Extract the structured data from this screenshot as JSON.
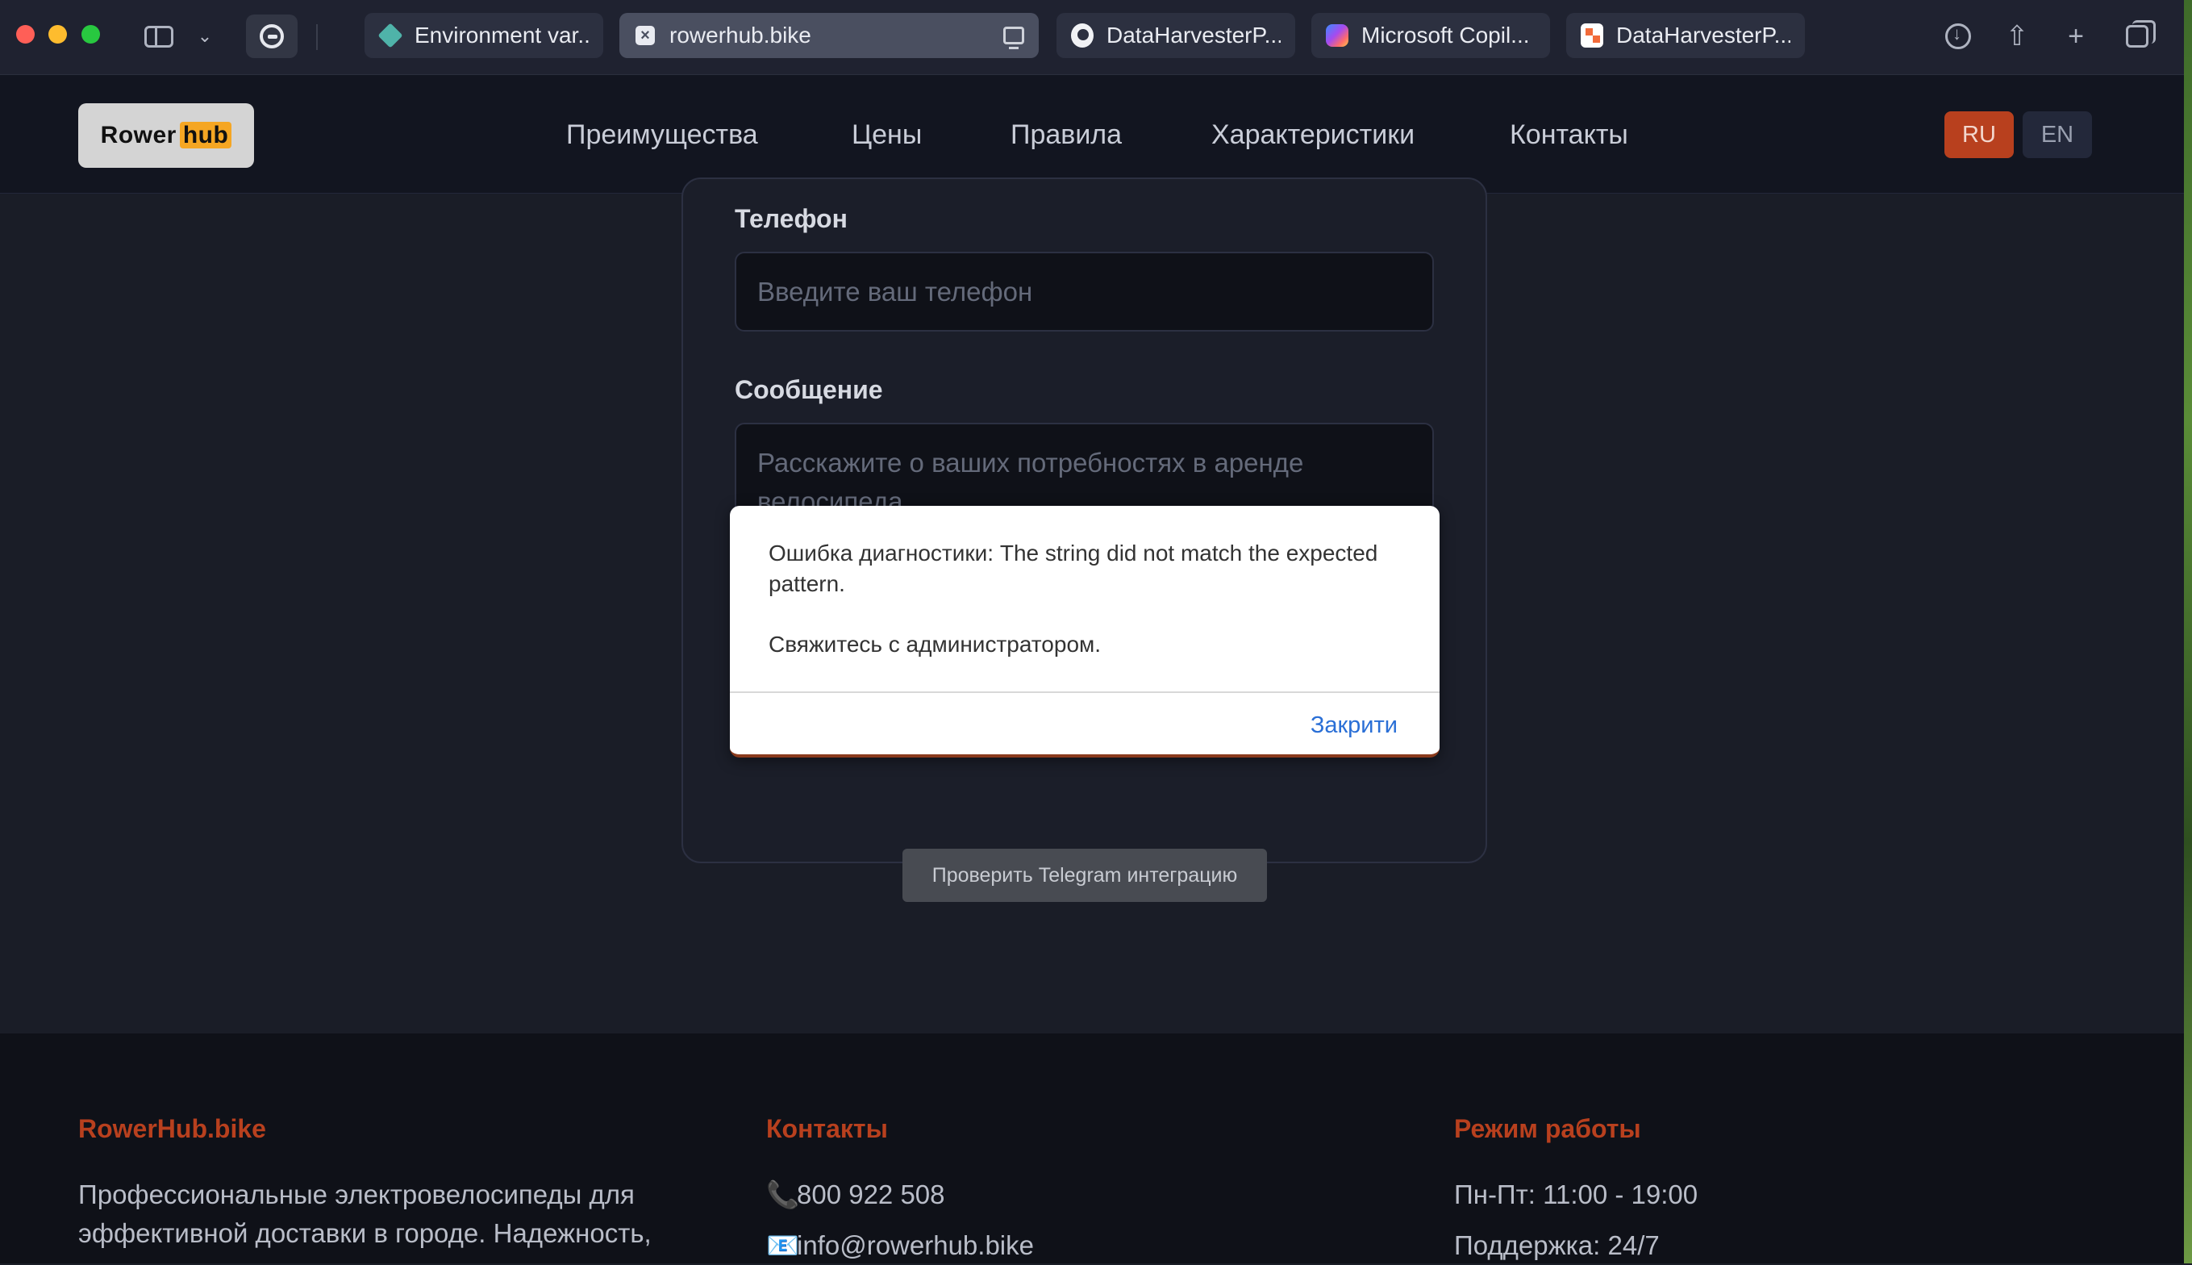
{
  "browser": {
    "tabs": [
      {
        "label": "Environment var...",
        "icon": "diamond-icon",
        "active": false
      },
      {
        "label": "rowerhub.bike",
        "icon": "close-x-icon",
        "active": true
      },
      {
        "label": "DataHarvesterP...",
        "icon": "github-icon",
        "active": false
      },
      {
        "label": "Microsoft Copil...",
        "icon": "copilot-icon",
        "active": false
      },
      {
        "label": "DataHarvesterP...",
        "icon": "dataharvester-icon",
        "active": false
      }
    ]
  },
  "header": {
    "logo": {
      "part1": "Rower",
      "part2": "hub"
    },
    "nav": [
      "Преимущества",
      "Цены",
      "Правила",
      "Характеристики",
      "Контакты"
    ],
    "lang": {
      "ru": "RU",
      "en": "EN",
      "active": "RU"
    }
  },
  "form": {
    "phone_label": "Телефон",
    "phone_placeholder": "Введите ваш телефон",
    "message_label": "Сообщение",
    "message_placeholder_line1": "Расскажите о ваших потребностях в аренде",
    "message_placeholder_line2": "велосипеда"
  },
  "alert": {
    "message": "Ошибка диагностики: The string did not match the expected pattern.",
    "message2": "Свяжитесь с администратором.",
    "button": "Закрити"
  },
  "test_button": "Проверить Telegram интеграцию",
  "footer": {
    "brand": "RowerHub.bike",
    "brand_text_line1": "Профессиональные электровелосипеды для",
    "brand_text_line2": "эффективной доставки в городе. Надежность,",
    "contacts_title": "Контакты",
    "phone": "800 922 508",
    "email": "info@rowerhub.bike",
    "hours_title": "Режим работы",
    "hours": "Пн-Пт: 11:00 - 19:00",
    "support": "Поддержка: 24/7"
  },
  "colors": {
    "accent": "#b8401e",
    "link": "#2a6fd6",
    "background": "#1a1d27"
  }
}
